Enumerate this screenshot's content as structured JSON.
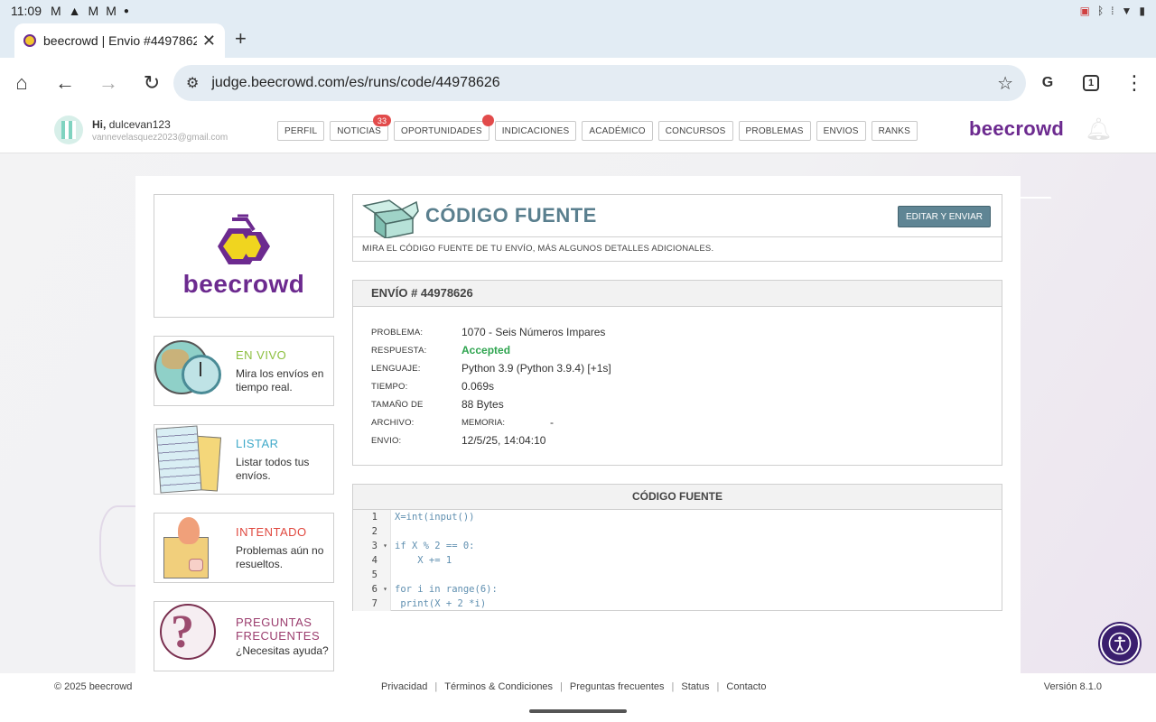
{
  "status_bar": {
    "time": "11:09",
    "left_icons": [
      "gmail-icon",
      "warning-icon",
      "gmail-icon",
      "gmail-icon",
      "dot-icon"
    ],
    "right_icons": [
      "cast-icon",
      "bluetooth-icon",
      "vibrate-icon",
      "wifi-icon",
      "battery-icon"
    ]
  },
  "browser": {
    "tab_title": "beecrowd | Envio #44978626",
    "url": "judge.beecrowd.com/es/runs/code/44978626",
    "tab_count": "1"
  },
  "header": {
    "greeting": "Hi,",
    "username": "dulcevan123",
    "email": "vannevelasquez2023@gmail.com",
    "nav": [
      {
        "label": "PERFIL"
      },
      {
        "label": "NOTICIAS",
        "badge": "33"
      },
      {
        "label": "OPORTUNIDADES",
        "dot": true
      },
      {
        "label": "INDICACIONES"
      },
      {
        "label": "ACADÉMICO"
      },
      {
        "label": "CONCURSOS"
      },
      {
        "label": "PROBLEMAS"
      },
      {
        "label": "ENVIOS"
      },
      {
        "label": "RANKS"
      }
    ],
    "brand": "beecrowd"
  },
  "sidebar": {
    "logo_word": "beecrowd",
    "items": [
      {
        "title": "EN VIVO",
        "desc": "Mira los envíos en tiempo real.",
        "color": "#8cbf3f"
      },
      {
        "title": "LISTAR",
        "desc": "Listar todos tus envíos.",
        "color": "#3fa9c9"
      },
      {
        "title": "INTENTADO",
        "desc": "Problemas aún no resueltos.",
        "color": "#e0483f"
      },
      {
        "title": "PREGUNTAS FRECUENTES",
        "desc": "¿Necesitas ayuda?",
        "color": "#9b3d6e"
      }
    ]
  },
  "main": {
    "title": "CÓDIGO FUENTE",
    "edit_button": "EDITAR Y ENVIAR",
    "subtitle": "MIRA EL CÓDIGO FUENTE DE TU ENVÍO, MÁS ALGUNOS DETALLES ADICIONALES.",
    "envio": {
      "heading": "ENVÍO # 44978626",
      "rows": [
        {
          "label": "PROBLEMA:",
          "value": "1070 - Seis Números Impares"
        },
        {
          "label": "RESPUESTA:",
          "value": "Accepted"
        },
        {
          "label": "LENGUAJE:",
          "value": "Python 3.9 (Python 3.9.4) [+1s]"
        },
        {
          "label": "TIEMPO:",
          "value": "0.069s"
        },
        {
          "label": "TAMAÑO DE",
          "value": "88 Bytes"
        },
        {
          "label": "ARCHIVO:",
          "sublabel": "MEMORIA:",
          "value": "-"
        },
        {
          "label": "ENVIO:",
          "value": "12/5/25, 14:04:10"
        }
      ]
    },
    "code": {
      "heading": "CÓDIGO FUENTE",
      "line_numbers": [
        "1",
        "2",
        "3",
        "4",
        "5",
        "6",
        "7"
      ],
      "lines": [
        "X=int(input())",
        "",
        "if X % 2 == 0:",
        "    X += 1",
        "",
        "for i in range(6):",
        " print(X + 2 *i)"
      ]
    }
  },
  "footer": {
    "copyright": "© 2025 beecrowd",
    "links": [
      "Privacidad",
      "Términos & Condiciones",
      "Preguntas frecuentes",
      "Status",
      "Contacto"
    ],
    "version": "Versión 8.1.0"
  }
}
